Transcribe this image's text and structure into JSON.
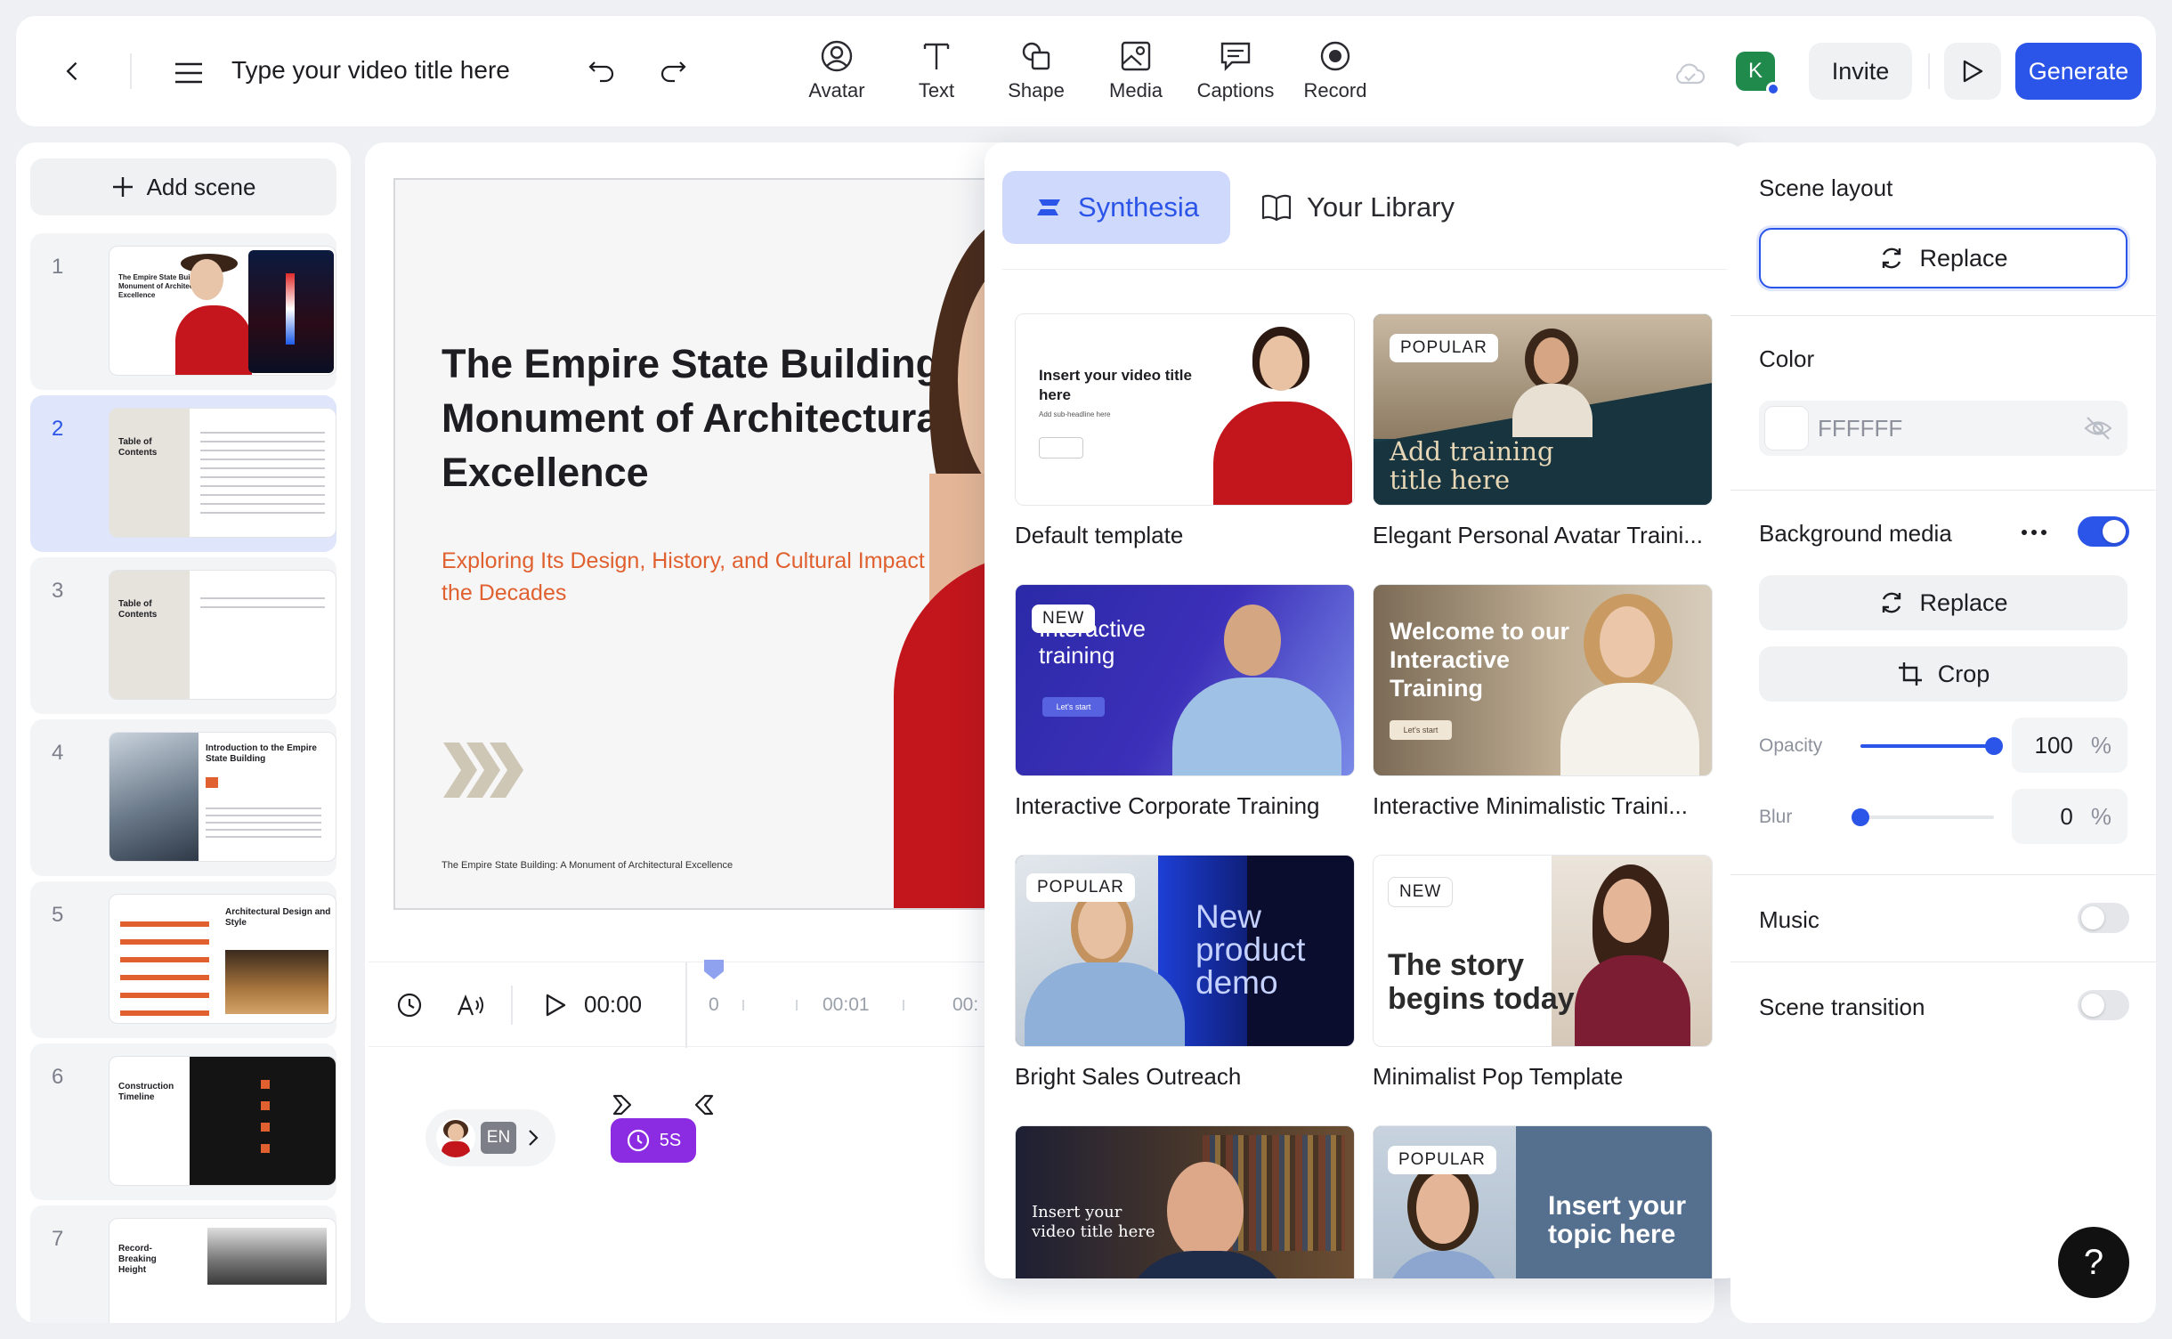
{
  "header": {
    "title_placeholder": "Type your video title here",
    "tools": [
      {
        "label": "Avatar",
        "icon": "avatar-icon"
      },
      {
        "label": "Text",
        "icon": "text-icon"
      },
      {
        "label": "Shape",
        "icon": "shape-icon"
      },
      {
        "label": "Media",
        "icon": "media-icon"
      },
      {
        "label": "Captions",
        "icon": "captions-icon"
      },
      {
        "label": "Record",
        "icon": "record-icon"
      }
    ],
    "user_initial": "K",
    "invite_label": "Invite",
    "generate_label": "Generate"
  },
  "sidebar": {
    "add_scene_label": "Add scene",
    "scenes": [
      {
        "number": "1",
        "thumb_title": "The Empire State Building: Monument of Architectural Excellence"
      },
      {
        "number": "2",
        "thumb_title": "Table of Contents"
      },
      {
        "number": "3",
        "thumb_title": "Table of Contents"
      },
      {
        "number": "4",
        "thumb_title": "Introduction to the Empire State Building"
      },
      {
        "number": "5",
        "thumb_title": "Architectural Design and Style"
      },
      {
        "number": "6",
        "thumb_title": "Construction Timeline"
      },
      {
        "number": "7",
        "thumb_title": "Record-Breaking Height"
      }
    ]
  },
  "slide": {
    "title": "The Empire State Building: Monument of Architectural Excellence",
    "subtitle": "Exploring Its Design, History, and Cultural Impact Over the Decades",
    "footer": "The Empire State Building: A Monument of Architectural Excellence"
  },
  "timeline": {
    "time": "00:00",
    "ticks": [
      "0",
      "00:01",
      "00:"
    ],
    "language": "EN",
    "duration_badge": "5S"
  },
  "templates_popup": {
    "tabs": [
      {
        "label": "Synthesia",
        "active": true
      },
      {
        "label": "Your Library",
        "active": false
      }
    ],
    "templates": [
      {
        "name": "Default template",
        "badge": "",
        "preview_title": "Insert your video title here",
        "preview_sub": "Add sub-headline here"
      },
      {
        "name": "Elegant Personal Avatar Traini...",
        "badge": "POPULAR",
        "preview_title": "Add training title here"
      },
      {
        "name": "Interactive Corporate Training",
        "badge": "NEW",
        "preview_title": "Interactive training",
        "preview_btn": "Let's start"
      },
      {
        "name": "Interactive Minimalistic Traini...",
        "badge": "",
        "preview_title": "Welcome to our Interactive Training",
        "preview_btn": "Let's start"
      },
      {
        "name": "Bright Sales Outreach",
        "badge": "POPULAR",
        "preview_title": "New product demo"
      },
      {
        "name": "Minimalist Pop Template",
        "badge": "NEW",
        "preview_title": "The story begins today"
      },
      {
        "name": "",
        "badge": "",
        "preview_title": "Insert your video title here"
      },
      {
        "name": "",
        "badge": "POPULAR",
        "preview_title": "Insert your topic here"
      }
    ]
  },
  "properties": {
    "scene_layout_label": "Scene layout",
    "replace_label": "Replace",
    "color_label": "Color",
    "color_value": "FFFFFF",
    "background_media_label": "Background media",
    "background_media_on": true,
    "media_replace_label": "Replace",
    "crop_label": "Crop",
    "opacity_label": "Opacity",
    "opacity_value": "100",
    "opacity_level": 1.0,
    "blur_label": "Blur",
    "blur_value": "0",
    "blur_level": 0.0,
    "percent": "%",
    "music_label": "Music",
    "music_on": false,
    "scene_transition_label": "Scene transition",
    "scene_transition_on": false
  },
  "colors": {
    "accent": "#2b54e8",
    "slide_subtitle": "#e0602f",
    "duration_badge": "#8b2be2"
  }
}
